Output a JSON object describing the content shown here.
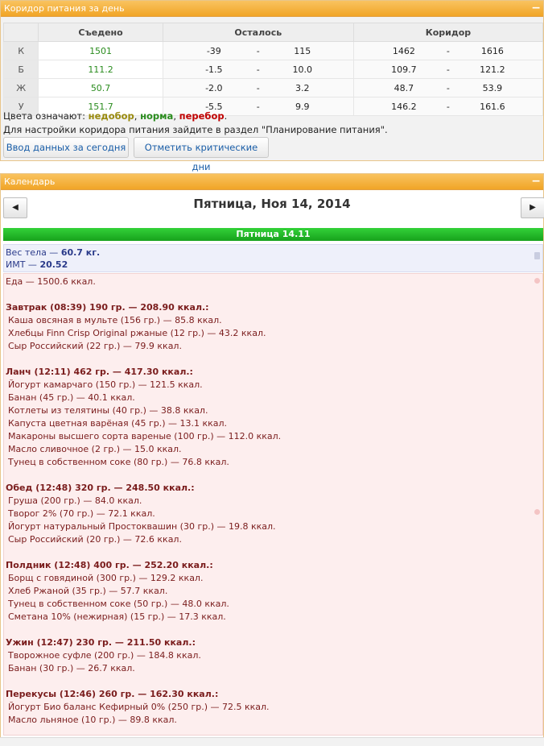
{
  "corridor_panel": {
    "title": "Коридор питания за день",
    "collapse": "−",
    "headers": {
      "eaten": "Съедено",
      "remaining": "Осталось",
      "corridor": "Коридор"
    },
    "rows": [
      {
        "label": "К",
        "eaten": "1501",
        "rem_min": "-39",
        "rem_dash": "-",
        "rem_max": "115",
        "cor_min": "1462",
        "cor_dash": "-",
        "cor_max": "1616"
      },
      {
        "label": "Б",
        "eaten": "111.2",
        "rem_min": "-1.5",
        "rem_dash": "-",
        "rem_max": "10.0",
        "cor_min": "109.7",
        "cor_dash": "-",
        "cor_max": "121.2"
      },
      {
        "label": "Ж",
        "eaten": "50.7",
        "rem_min": "-2.0",
        "rem_dash": "-",
        "rem_max": "3.2",
        "cor_min": "48.7",
        "cor_dash": "-",
        "cor_max": "53.9"
      },
      {
        "label": "У",
        "eaten": "151.7",
        "rem_min": "-5.5",
        "rem_dash": "-",
        "rem_max": "9.9",
        "cor_min": "146.2",
        "cor_dash": "-",
        "cor_max": "161.6"
      }
    ],
    "legend_prefix": "Цвета означают:",
    "legend_under": "недобор",
    "legend_sep1": ",",
    "legend_norm": "норма",
    "legend_sep2": ",",
    "legend_over": "перебор",
    "legend_end": ".",
    "settings_text": "Для настройки коридора питания зайдите в раздел \"Планирование питания\".",
    "btn_input": "Ввод данных за сегодня",
    "btn_critical": "Отметить критические дни"
  },
  "calendar": {
    "title": "Календарь",
    "collapse": "−",
    "prev": "◀",
    "next": "▶",
    "date": "Пятница, Ноя 14, 2014",
    "day_label": "Пятница 14.11",
    "weight_label": "Вес тела — ",
    "weight_value": "60.7 кг.",
    "bmi_label": "ИМТ — ",
    "bmi_value": "20.52",
    "food_total": "Еда — 1500.6 ккал.",
    "meals": [
      {
        "header": "Завтрак (08:39) 190 гр. — 208.90 ккал.:",
        "items": [
          "Каша овсяная в мульте (156 гр.) — 85.8 ккал.",
          "Хлебцы Finn Crisp Original ржаные (12 гр.) — 43.2 ккал.",
          "Сыр Российский (22 гр.) — 79.9 ккал."
        ]
      },
      {
        "header": "Ланч (12:11) 462 гр. — 417.30 ккал.:",
        "items": [
          "Йогурт камарчаго (150 гр.) — 121.5 ккал.",
          "Банан (45 гр.) — 40.1 ккал.",
          "Котлеты из телятины (40 гр.) — 38.8 ккал.",
          "Капуста цветная варёная (45 гр.) — 13.1 ккал.",
          "Макароны высшего сорта вареные (100 гр.) — 112.0 ккал.",
          "Масло сливочное (2 гр.) — 15.0 ккал.",
          "Тунец в собственном соке (80 гр.) — 76.8 ккал."
        ]
      },
      {
        "header": "Обед (12:48) 320 гр. — 248.50 ккал.:",
        "items": [
          "Груша (200 гр.) — 84.0 ккал.",
          "Творог 2% (70 гр.) — 72.1 ккал.",
          "Йогурт натуральный Простоквашин (30 гр.) — 19.8 ккал.",
          "Сыр Российский (20 гр.) — 72.6 ккал."
        ]
      },
      {
        "header": "Полдник (12:48) 400 гр. — 252.20 ккал.:",
        "items": [
          "Борщ с говядиной (300 гр.) — 129.2 ккал.",
          "Хлеб Ржаной (35 гр.) — 57.7 ккал.",
          "Тунец в собственном соке (50 гр.) — 48.0 ккал.",
          "Сметана 10% (нежирная) (15 гр.) — 17.3 ккал."
        ]
      },
      {
        "header": "Ужин (12:47) 230 гр. — 211.50 ккал.:",
        "items": [
          "Творожное суфле (200 гр.) — 184.8 ккал.",
          "Банан (30 гр.) — 26.7 ккал."
        ]
      },
      {
        "header": "Перекусы (12:46) 260 гр. — 162.30 ккал.:",
        "items": [
          "Йогурт Био баланс Кефирный 0% (250 гр.) — 72.5 ккал.",
          "Масло льняное (10 гр.) — 89.8 ккал."
        ]
      }
    ]
  }
}
